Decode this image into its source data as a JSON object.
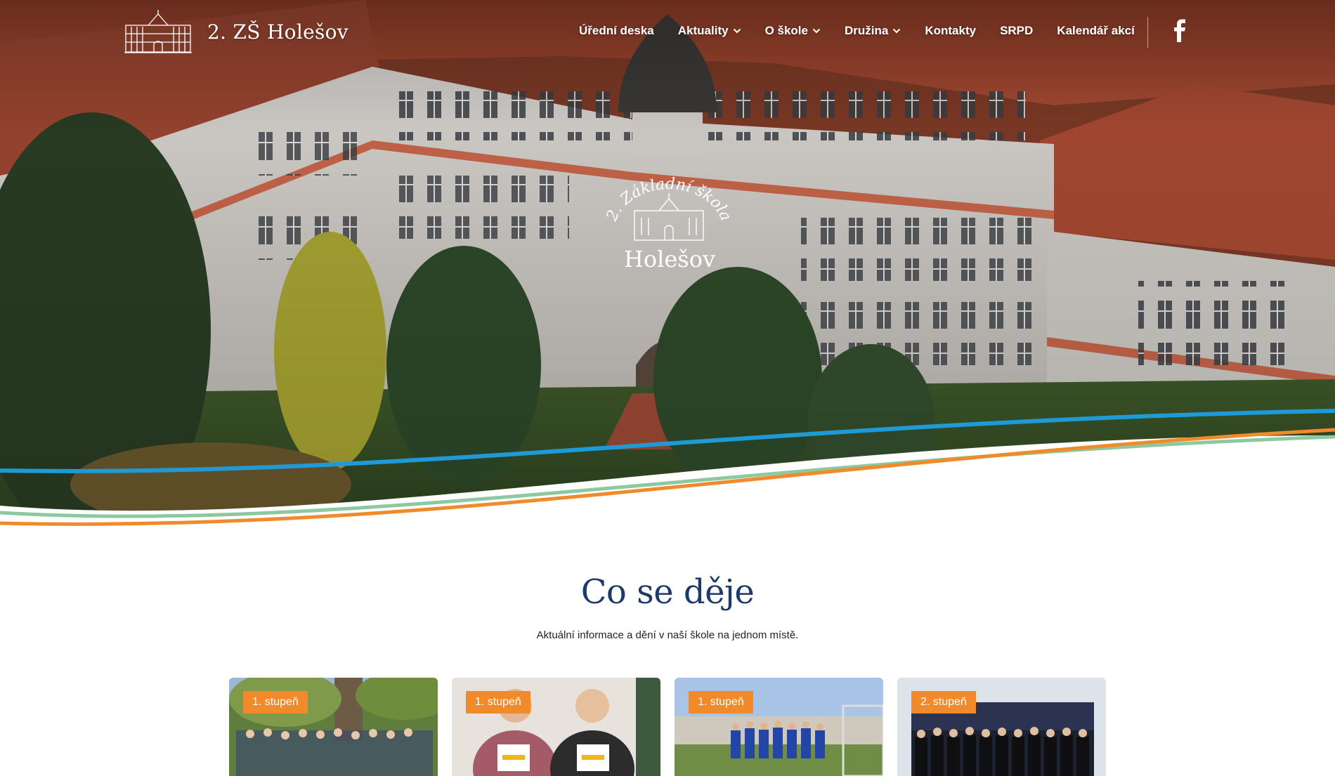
{
  "header": {
    "logo_text": "2. ZŠ Holešov",
    "nav": [
      {
        "label": "Úřední deska",
        "dropdown": false
      },
      {
        "label": "Aktuality",
        "dropdown": true
      },
      {
        "label": "O škole",
        "dropdown": true
      },
      {
        "label": "Družina",
        "dropdown": true
      },
      {
        "label": "Kontakty",
        "dropdown": false
      },
      {
        "label": "SRPD",
        "dropdown": false
      },
      {
        "label": "Kalendář akcí",
        "dropdown": false
      }
    ],
    "social_icon": "facebook-icon"
  },
  "hero": {
    "emblem_arc_text": "2. Základní škola",
    "emblem_town": "Holešov"
  },
  "section": {
    "title": "Co se děje",
    "subtitle": "Aktuální informace a dění v naší škole na jednom místě."
  },
  "cards": [
    {
      "badge": "1. stupeň"
    },
    {
      "badge": "1. stupeň"
    },
    {
      "badge": "1. stupeň"
    },
    {
      "badge": "2. stupeň"
    }
  ],
  "colors": {
    "accent_orange": "#f18a2a",
    "title_navy": "#1d3a6b",
    "wave_blue": "#1e9ad6",
    "wave_green": "#8cc9a0"
  }
}
